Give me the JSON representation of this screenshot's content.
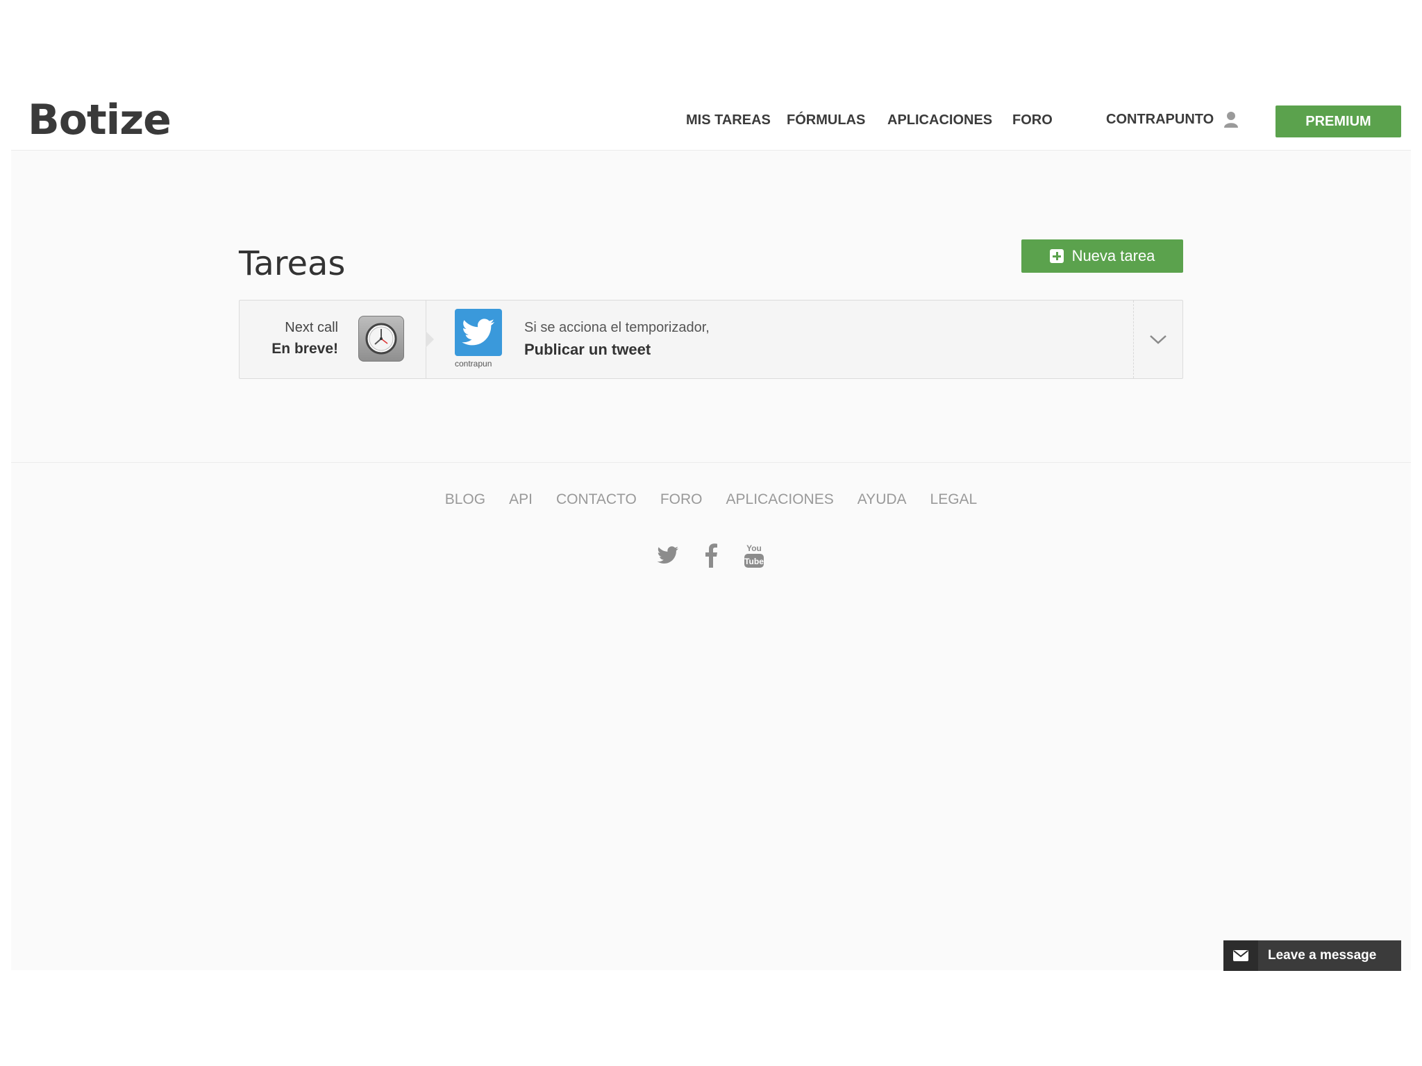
{
  "header": {
    "logo": "Botize",
    "nav": [
      "MIS TAREAS",
      "FÓRMULAS",
      "APLICACIONES",
      "FORO"
    ],
    "user_label": "CONTRAPUNTO",
    "premium_label": "PREMIUM"
  },
  "main": {
    "title": "Tareas",
    "new_task_label": "Nueva tarea",
    "task": {
      "next_call_label": "Next call",
      "next_call_value": "En breve!",
      "app_account": "contrapun",
      "condition": "Si se acciona el temporizador,",
      "action": "Publicar un tweet"
    }
  },
  "footer": {
    "links": [
      "BLOG",
      "API",
      "CONTACTO",
      "FORO",
      "APLICACIONES",
      "AYUDA",
      "LEGAL"
    ],
    "social": [
      "twitter-icon",
      "facebook-icon",
      "youtube-icon"
    ]
  },
  "chat": {
    "label": "Leave a message"
  },
  "colors": {
    "accent_green": "#5ba24d",
    "twitter_blue": "#3a99db",
    "chat_dark": "#3b3b3b"
  }
}
